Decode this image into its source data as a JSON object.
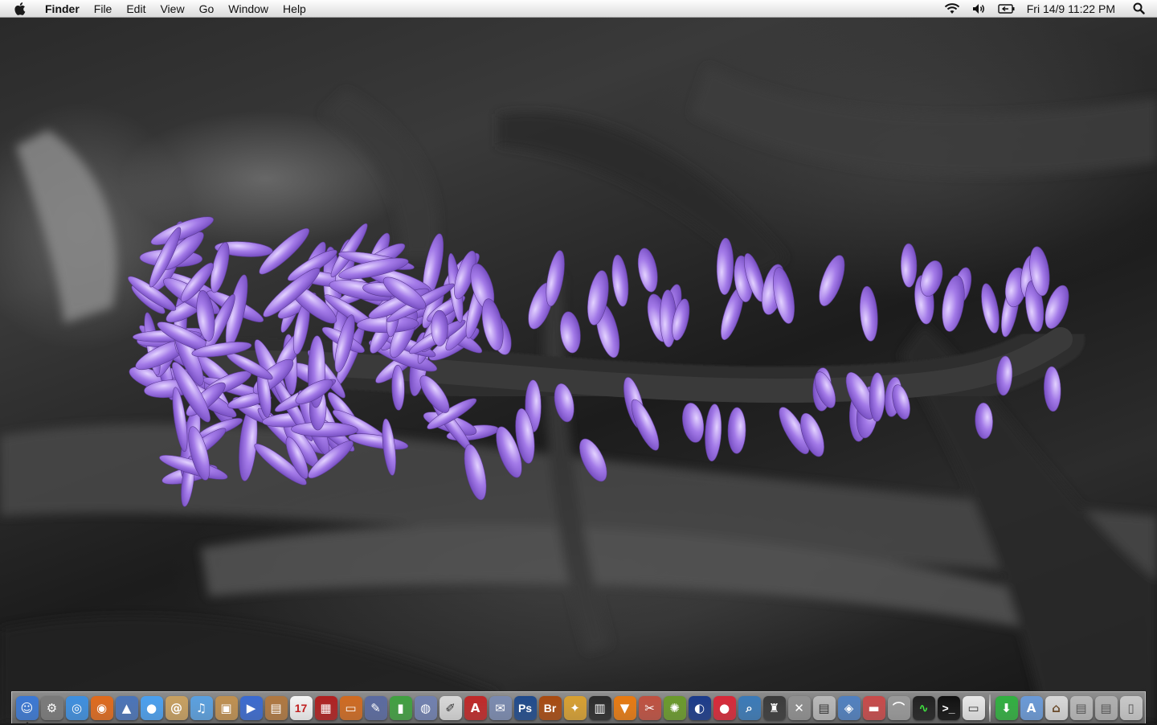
{
  "menubar": {
    "app_name": "Finder",
    "menus": [
      "File",
      "Edit",
      "View",
      "Go",
      "Window",
      "Help"
    ],
    "status_icons": [
      "wifi-icon",
      "volume-icon",
      "battery-icon"
    ],
    "clock": "Fri 14/9 11:22 PM",
    "spotlight_icon": "spotlight-search-icon"
  },
  "wallpaper": {
    "subject": "purple flower spike on a desaturated background",
    "accent_color": "#9b6fe0"
  },
  "dock": {
    "apps": [
      {
        "name": "finder-icon",
        "glyph": "☺",
        "bg": "#3a78d4",
        "running": true
      },
      {
        "name": "system-preferences-icon",
        "glyph": "⚙",
        "bg": "#7a7a7a"
      },
      {
        "name": "safari-icon",
        "glyph": "◎",
        "bg": "#3d8fe0"
      },
      {
        "name": "firefox-icon",
        "glyph": "◉",
        "bg": "#e06a1c"
      },
      {
        "name": "preview-icon",
        "glyph": "▲",
        "bg": "#4a74b8"
      },
      {
        "name": "ichat-icon",
        "glyph": "●",
        "bg": "#4aa0f0"
      },
      {
        "name": "address-book-icon",
        "glyph": "@",
        "bg": "#c8a060"
      },
      {
        "name": "itunes-icon",
        "glyph": "♫",
        "bg": "#5aa0e0"
      },
      {
        "name": "iphoto-icon",
        "glyph": "▣",
        "bg": "#c09050"
      },
      {
        "name": "imovie-icon",
        "glyph": "▶",
        "bg": "#3a6ad0"
      },
      {
        "name": "photo-booth-icon",
        "glyph": "▤",
        "bg": "#b07840"
      },
      {
        "name": "ical-icon",
        "glyph": "17",
        "bg": "#f4f4f4",
        "fg": "#c02020"
      },
      {
        "name": "photo-viewer-icon",
        "glyph": "▦",
        "bg": "#b02020"
      },
      {
        "name": "keynote-icon",
        "glyph": "▭",
        "bg": "#d06a20"
      },
      {
        "name": "script-editor-icon",
        "glyph": "✎",
        "bg": "#5a6aa0"
      },
      {
        "name": "numbers-icon",
        "glyph": "▮",
        "bg": "#40a040"
      },
      {
        "name": "quicktime-icon",
        "glyph": "◍",
        "bg": "#7080b0"
      },
      {
        "name": "textedit-icon",
        "glyph": "✐",
        "bg": "#d8d8d8",
        "fg": "#333"
      },
      {
        "name": "acrobat-icon",
        "glyph": "A",
        "bg": "#c02828"
      },
      {
        "name": "image-capture-icon",
        "glyph": "✉",
        "bg": "#7a8ab0"
      },
      {
        "name": "photoshop-icon",
        "glyph": "Ps",
        "bg": "#1f4a8c"
      },
      {
        "name": "bridge-icon",
        "glyph": "Br",
        "bg": "#a84a10"
      },
      {
        "name": "stuffit-icon",
        "glyph": "✦",
        "bg": "#d8a030"
      },
      {
        "name": "cd-burner-icon",
        "glyph": "▥",
        "bg": "#2a2a2a"
      },
      {
        "name": "vlc-icon",
        "glyph": "▼",
        "bg": "#e87a10"
      },
      {
        "name": "automator-icon",
        "glyph": "✂",
        "bg": "#c05040"
      },
      {
        "name": "dashboard-icon",
        "glyph": "✺",
        "bg": "#6a9a2a"
      },
      {
        "name": "google-earth-icon",
        "glyph": "◐",
        "bg": "#1a3a8a"
      },
      {
        "name": "flickr-uploadr-icon",
        "glyph": "●",
        "bg": "#d82838"
      },
      {
        "name": "magnifier-icon",
        "glyph": "⌕",
        "bg": "#3a7ab8"
      },
      {
        "name": "spirited-away-icon",
        "glyph": "♜",
        "bg": "#3a3a3a"
      },
      {
        "name": "mac-os-x-icon",
        "glyph": "✕",
        "bg": "#909090"
      },
      {
        "name": "system-profiler-icon",
        "glyph": "▤",
        "bg": "#b8b8b8",
        "fg": "#333"
      },
      {
        "name": "colorsync-icon",
        "glyph": "◈",
        "bg": "#5080c0"
      },
      {
        "name": "disk-utility-icon",
        "glyph": "▬",
        "bg": "#c84a4a"
      },
      {
        "name": "airport-utility-icon",
        "glyph": "⌒",
        "bg": "#9a9a9a"
      },
      {
        "name": "activity-monitor-icon",
        "glyph": "∿",
        "bg": "#202020",
        "fg": "#40e040"
      },
      {
        "name": "terminal-icon",
        "glyph": ">_",
        "bg": "#101010"
      },
      {
        "name": "printer-icon",
        "glyph": "▭",
        "bg": "#e8e8e8",
        "fg": "#333"
      }
    ],
    "stacks": [
      {
        "name": "downloads-stack-icon",
        "glyph": "⬇",
        "bg": "#30b040"
      },
      {
        "name": "applications-folder-icon",
        "glyph": "A",
        "bg": "#6a9ad8"
      },
      {
        "name": "home-folder-icon",
        "glyph": "⌂",
        "bg": "#d8d8d8",
        "fg": "#6a4a2a"
      },
      {
        "name": "hard-drive-icon",
        "glyph": "▤",
        "bg": "#b8b8b8",
        "fg": "#555"
      },
      {
        "name": "external-drive-icon",
        "glyph": "▤",
        "bg": "#b0b0b0",
        "fg": "#555"
      },
      {
        "name": "trash-icon",
        "glyph": "▯",
        "bg": "#c8c8c8",
        "fg": "#555"
      }
    ]
  }
}
